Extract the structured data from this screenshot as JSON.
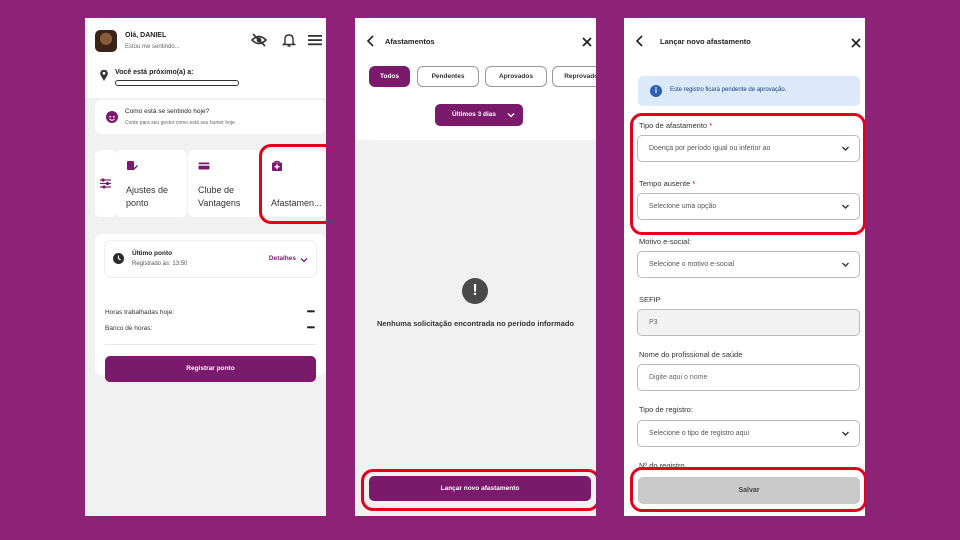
{
  "colors": {
    "background": "#8c2377",
    "brand": "#7b1a6d",
    "highlight": "#e3001b",
    "info_bg": "#dbe9fb"
  },
  "home": {
    "greeting": "Olá, DANIEL",
    "mood_status": "Estou me sentindo...",
    "icons": [
      "eye-off-icon",
      "bell-icon",
      "menu-icon"
    ],
    "location_label": "Você está próximo(a) a:",
    "mood_card": {
      "title": "Como está se sentindo hoje?",
      "subtitle": "Conte para seu gestor como está seu humor hoje."
    },
    "shortcuts": [
      {
        "label": "Ajustes de ponto",
        "icon": "edit-clock-icon"
      },
      {
        "label": "Clube de Vantagens",
        "icon": "card-icon"
      },
      {
        "label": "Afastamen...",
        "icon": "medical-bag-icon"
      }
    ],
    "last_punch": {
      "title": "Último ponto",
      "registered": "Registrado às: 13:50",
      "details_label": "Detalhes"
    },
    "hours_today_label": "Horas trabalhadas hoje:",
    "hours_today_value": "••••",
    "hour_bank_label": "Banco de horas:",
    "hour_bank_value": "••••",
    "register_button": "Registrar ponto"
  },
  "absences": {
    "title": "Afastamentos",
    "tabs": [
      "Todos",
      "Pendentes",
      "Aprovados",
      "Reprovados"
    ],
    "active_tab": "Todos",
    "period_filter": "Últimos 3 dias",
    "empty_message": "Nenhuma solicitação encontrada no período informado",
    "new_button": "Lançar novo afastamento"
  },
  "new_absence": {
    "title": "Lançar novo afastamento",
    "info": "Este registro ficará pendente de aprovação.",
    "fields": {
      "tipo": {
        "label": "Tipo de afastamento",
        "value": "Doença por período igual ou inferior ao"
      },
      "tempo": {
        "label": "Tempo ausente",
        "placeholder": "Selecione uma opção"
      },
      "motivo": {
        "label": "Motivo e-social:",
        "placeholder": "Selecione o motivo e-social"
      },
      "sefip": {
        "label": "SEFIP",
        "value": "P3"
      },
      "profissional": {
        "label": "Nome do profissional de saúde",
        "placeholder": "Digite aqui o nome"
      },
      "registro_tipo": {
        "label": "Tipo de registro:",
        "placeholder": "Selecione o tipo de registro aqui"
      },
      "registro_num": {
        "label": "Nº do registro"
      }
    },
    "save_button": "Salvar"
  }
}
